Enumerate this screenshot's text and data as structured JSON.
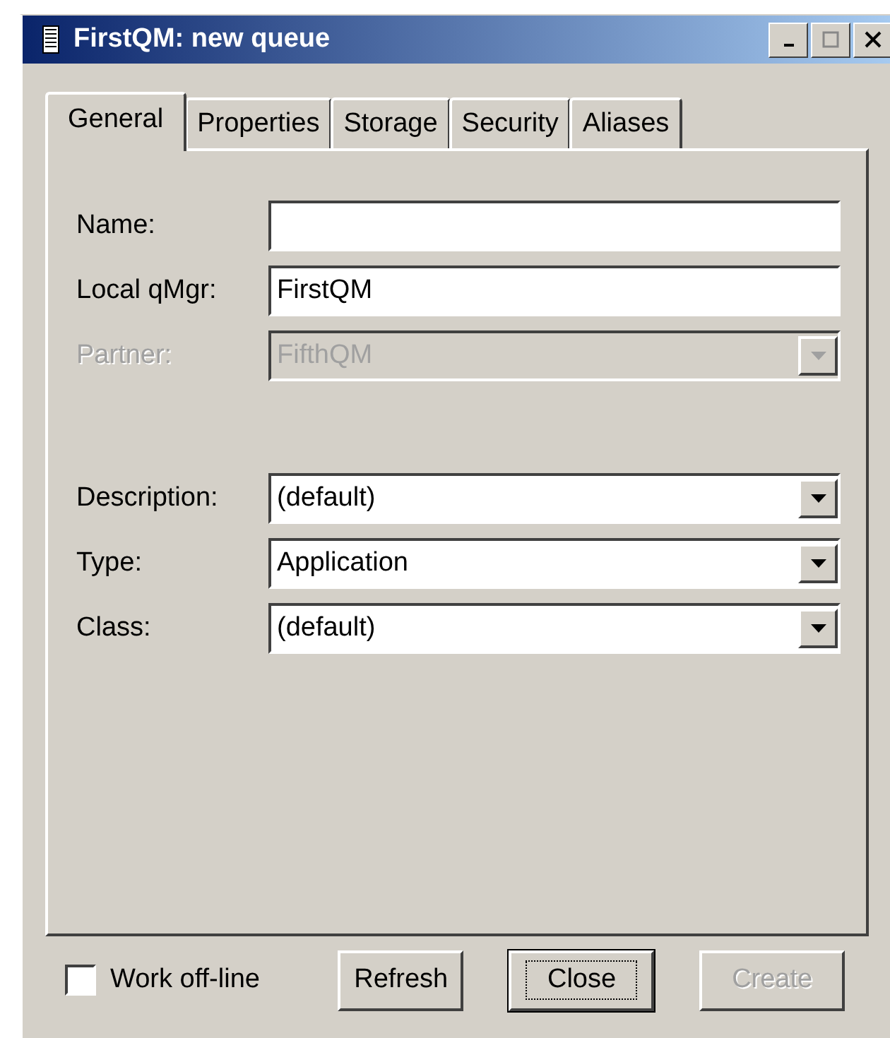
{
  "window": {
    "title": "FirstQM: new queue"
  },
  "tabs": [
    {
      "label": "General",
      "selected": true
    },
    {
      "label": "Properties",
      "selected": false
    },
    {
      "label": "Storage",
      "selected": false
    },
    {
      "label": "Security",
      "selected": false
    },
    {
      "label": "Aliases",
      "selected": false
    }
  ],
  "fields": [
    {
      "label": "Name:",
      "kind": "text",
      "disabled": false
    },
    {
      "label": "Local qMgr:",
      "kind": "text",
      "value": "FirstQM",
      "disabled": false
    },
    {
      "label": "Partner:",
      "kind": "combo",
      "value": "FifthQM",
      "disabled": true
    },
    {
      "kind": "gap"
    },
    {
      "label": "Description:",
      "kind": "combo",
      "value": "(default)",
      "disabled": false
    },
    {
      "label": "Type:",
      "kind": "combo",
      "value": "Application",
      "disabled": false
    },
    {
      "label": "Class:",
      "kind": "combo",
      "value": "(default)",
      "disabled": false
    }
  ],
  "work_offline": {
    "label": "Work off-line",
    "checked": false
  },
  "buttons": [
    {
      "label": "Refresh",
      "default": false,
      "disabled": false
    },
    {
      "label": "Close",
      "default": true,
      "disabled": false
    },
    {
      "label": "Create",
      "default": false,
      "disabled": true
    }
  ]
}
